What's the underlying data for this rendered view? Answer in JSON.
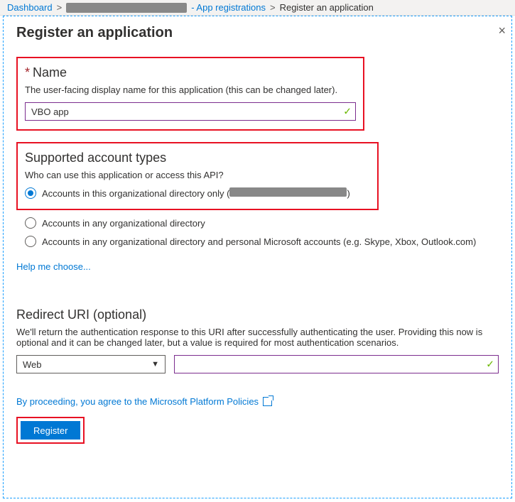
{
  "breadcrumb": {
    "dashboard": "Dashboard",
    "app_reg": "- App registrations",
    "current": "Register an application"
  },
  "page_title": "Register an application",
  "name_section": {
    "heading": "Name",
    "hint": "The user-facing display name for this application (this can be changed later).",
    "value": "VBO app"
  },
  "account_types": {
    "heading": "Supported account types",
    "hint": "Who can use this application or access this API?",
    "options": [
      {
        "label_pre": "Accounts in this organizational directory only (",
        "label_post": ")",
        "selected": true
      },
      {
        "label": "Accounts in any organizational directory",
        "selected": false
      },
      {
        "label": "Accounts in any organizational directory and personal Microsoft accounts (e.g. Skype, Xbox, Outlook.com)",
        "selected": false
      }
    ],
    "help_link": "Help me choose..."
  },
  "redirect": {
    "heading": "Redirect URI (optional)",
    "hint": "We'll return the authentication response to this URI after successfully authenticating the user. Providing this now is optional and it can be changed later, but a value is required for most authentication scenarios.",
    "type_value": "Web",
    "uri_value": ""
  },
  "agree_text": "By proceeding, you agree to the Microsoft Platform Policies",
  "register_label": "Register"
}
